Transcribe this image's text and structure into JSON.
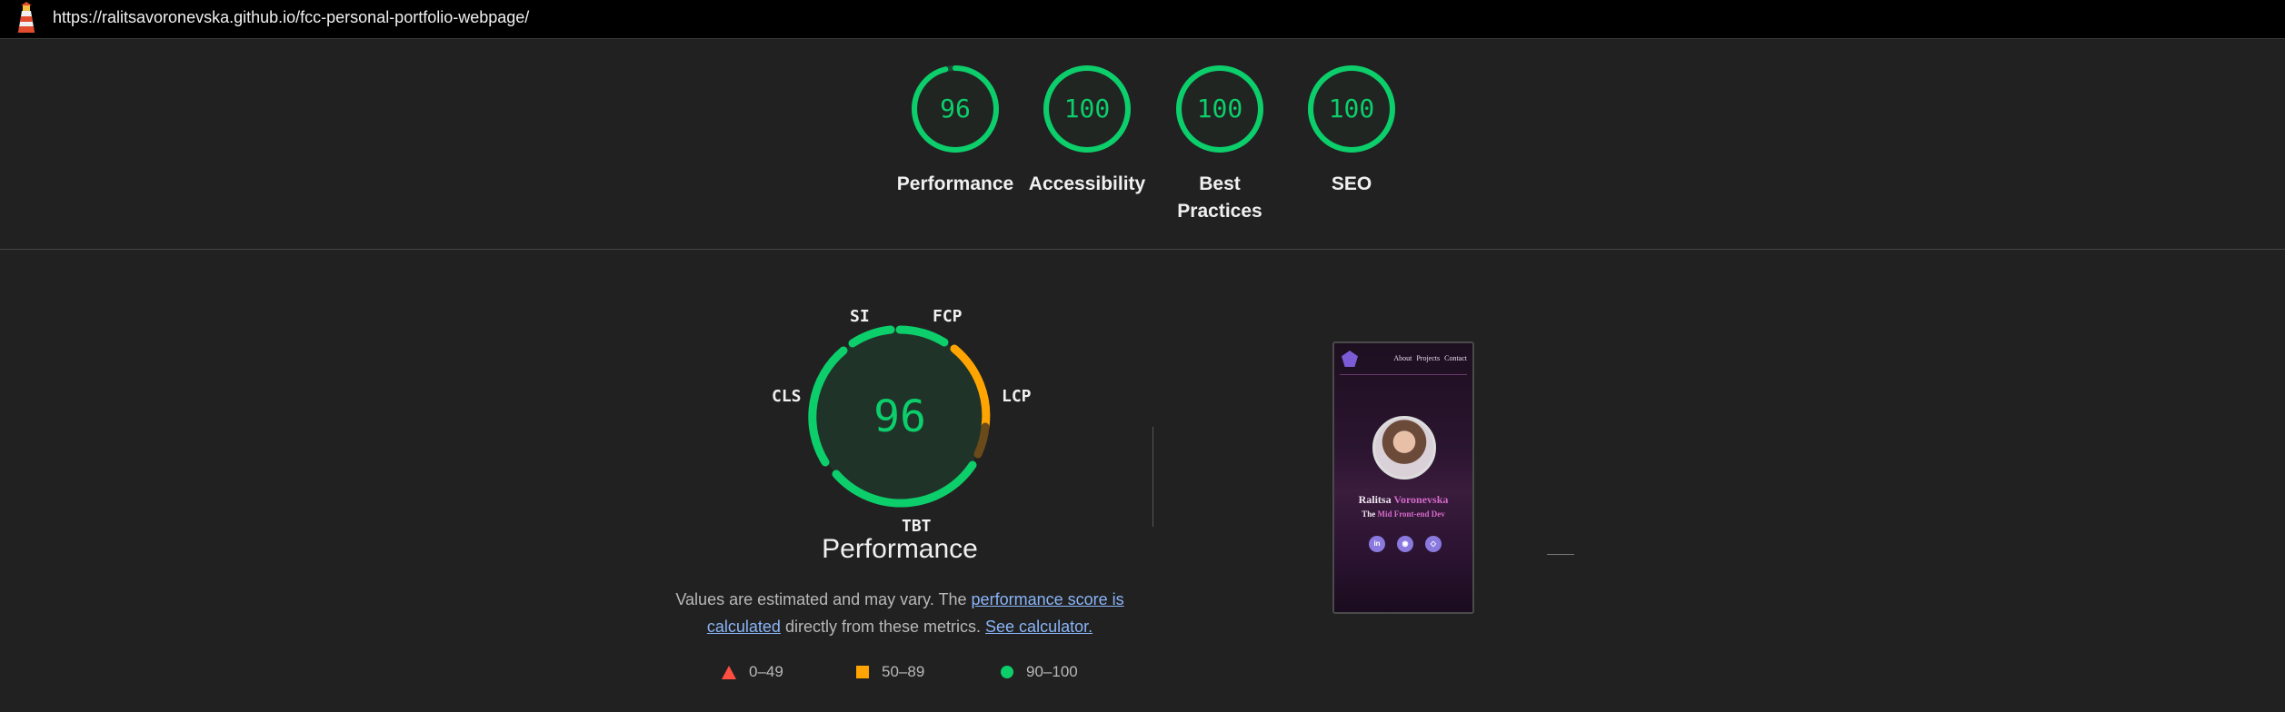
{
  "url_bar": {
    "url": "https://ralitsavoronevska.github.io/fcc-personal-portfolio-webpage/"
  },
  "colors": {
    "pass": "#0cce6b",
    "average": "#ffa400",
    "fail": "#ff4e42"
  },
  "categories": [
    {
      "label": "Performance",
      "score": "96",
      "fraction": 0.96
    },
    {
      "label": "Accessibility",
      "score": "100",
      "fraction": 1.0
    },
    {
      "label": "Best Practices",
      "score": "100",
      "fraction": 1.0
    },
    {
      "label": "SEO",
      "score": "100",
      "fraction": 1.0
    }
  ],
  "performance": {
    "score": "96",
    "title": "Performance",
    "metric_labels": {
      "si": "SI",
      "fcp": "FCP",
      "lcp": "LCP",
      "tbt": "TBT",
      "cls": "CLS"
    },
    "description_prefix": "Values are estimated and may vary. The ",
    "score_link": "performance score is calculated",
    "description_suffix": " directly from these metrics.",
    "calculator_link": "See calculator."
  },
  "legend": {
    "fail": "0–49",
    "average": "50–89",
    "pass": "90–100"
  },
  "preview": {
    "nav": [
      "About",
      "Projects",
      "Contact"
    ],
    "name_first": "Ralitsa",
    "name_last": "Voronevska",
    "role_prefix": "The",
    "role_highlight": "Mid Front-end Dev",
    "social_icons": [
      "linkedin-icon",
      "github-icon",
      "codepen-icon"
    ]
  }
}
